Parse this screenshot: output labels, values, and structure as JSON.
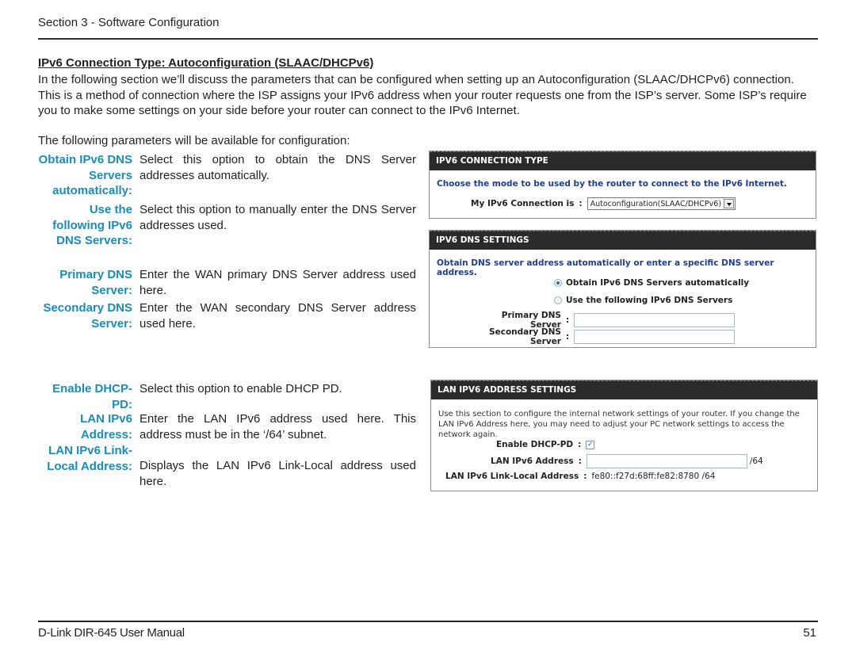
{
  "page": {
    "section_header": "Section 3 - Software Configuration",
    "title": "IPv6 Connection Type: Autoconfiguration (SLAAC/DHCPv6)",
    "intro": "In the following section we’ll discuss the parameters that can be configured when setting up an Autoconfiguration (SLAAC/DHCPv6) connection. This is a method of connection where the ISP assigns your IPv6 address when your router requests one from the ISP’s server. Some ISP’s require you to make some settings on your side before your router can connect to the IPv6 Internet.",
    "params_intro": "The following parameters will be available for configuration:"
  },
  "definitions": [
    {
      "term": "Obtain IPv6 DNS Servers automatically:",
      "desc": "Select this option to obtain the DNS Server addresses automatically."
    },
    {
      "term": "Use the following IPv6 DNS Servers:",
      "desc": "Select this option to manually enter the DNS Server addresses used."
    },
    {
      "term": "Primary DNS Server:",
      "desc": "Enter the WAN primary DNS Server address used here."
    },
    {
      "term": "Secondary DNS Server:",
      "desc": "Enter the WAN secondary DNS Server address used here."
    },
    {
      "term": "Enable DHCP-PD:",
      "desc": "Select this option to enable DHCP PD."
    },
    {
      "term": "LAN IPv6 Address:",
      "desc": "Enter the LAN IPv6 address used here. This address must be in the ‘/64’ subnet."
    },
    {
      "term": "LAN IPv6 Link-Local Address:",
      "desc": "Displays the LAN IPv6 Link-Local address used here."
    }
  ],
  "panels": {
    "connection_type": {
      "header": "IPV6 CONNECTION TYPE",
      "subtitle": "Choose the mode to be used by the router to connect to the IPv6 Internet.",
      "field_label": "My IPv6 Connection is",
      "colon": ":",
      "selected_value": "Autoconfiguration(SLAAC/DHCPv6)"
    },
    "dns_settings": {
      "header": "IPV6 DNS SETTINGS",
      "subtitle": "Obtain DNS server address automatically or enter a specific DNS server address.",
      "radio_auto": "Obtain IPv6 DNS Servers automatically",
      "radio_manual": "Use the following IPv6 DNS Servers",
      "selected": "auto",
      "primary_label": "Primary DNS Server",
      "primary_value": "",
      "secondary_label": "Secondary DNS Server",
      "secondary_value": "",
      "colon": ":"
    },
    "lan_settings": {
      "header": "LAN IPV6 ADDRESS SETTINGS",
      "note": "Use this section to configure the internal network settings of your router. If you change the LAN IPv6 Address here, you may need to adjust your PC network settings to access the network again.",
      "dhcp_pd_label": "Enable DHCP-PD",
      "dhcp_pd_checked": true,
      "check_glyph": "✓",
      "lan_address_label": "LAN IPv6 Address",
      "lan_address_value": "",
      "lan_address_suffix": "/64",
      "link_local_label": "LAN IPv6 Link-Local Address",
      "link_local_value": "fe80::f27d:68ff:fe82:8780 /64",
      "colon": ":"
    }
  },
  "footer": {
    "manual": "D-Link DIR-645 User Manual",
    "page_number": "51"
  }
}
